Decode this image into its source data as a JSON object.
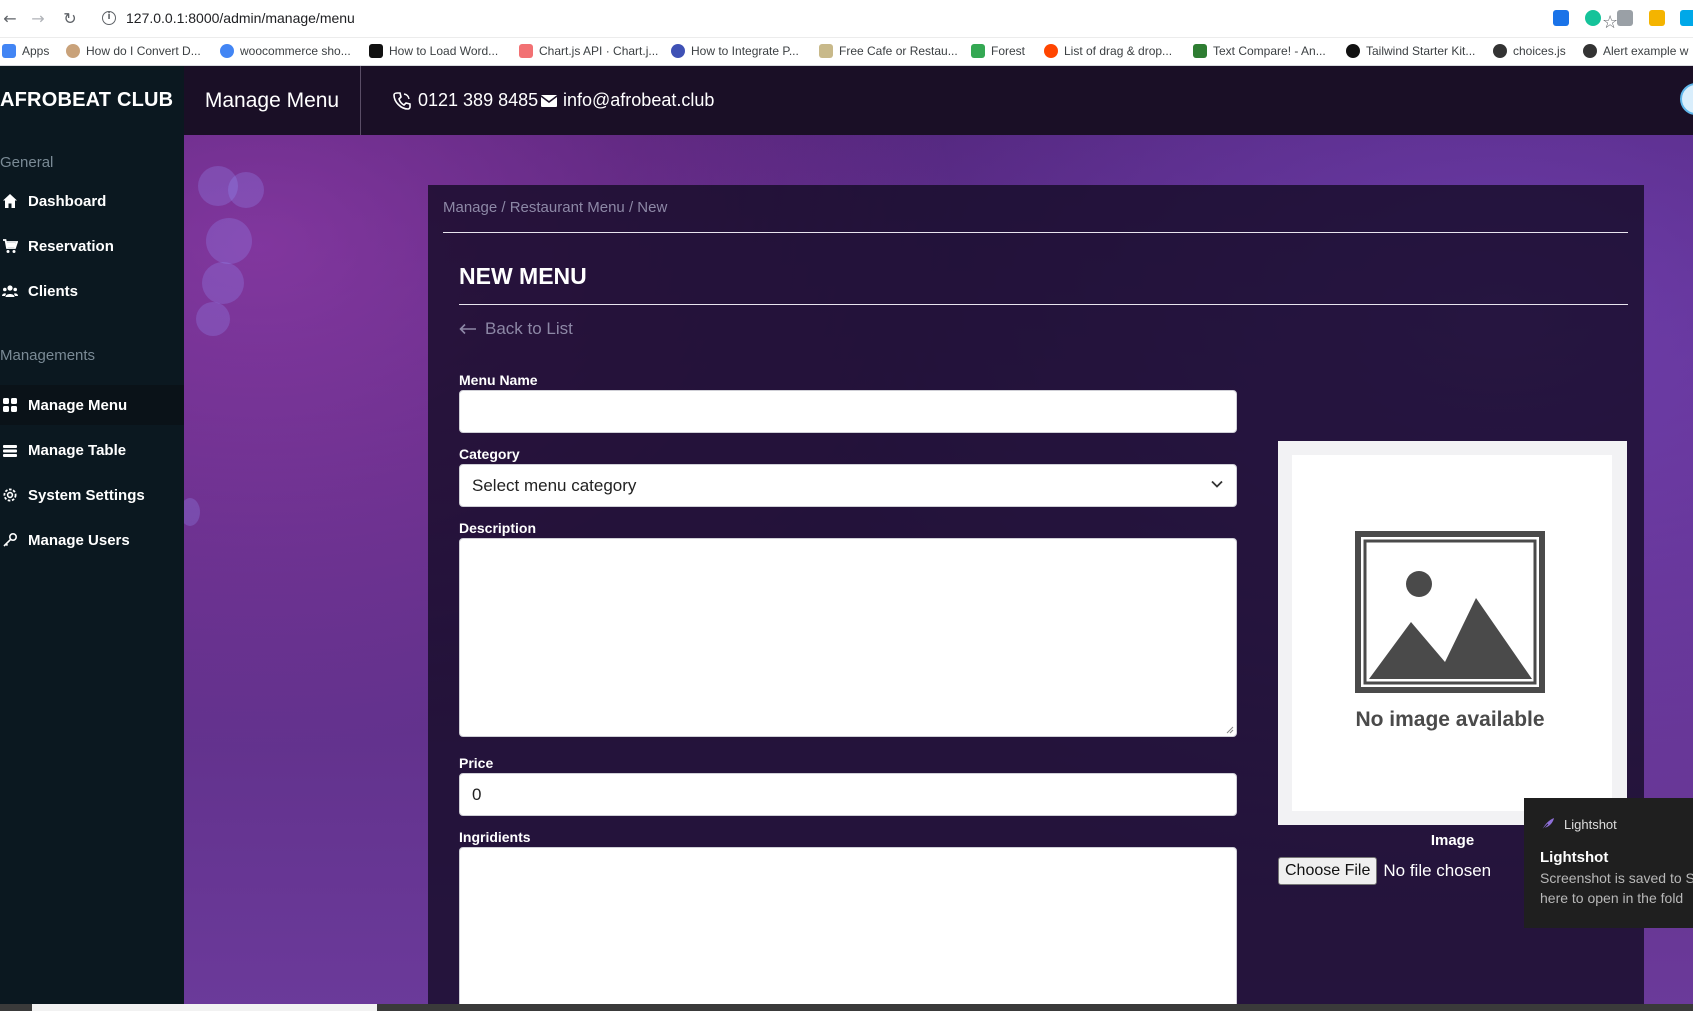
{
  "browser": {
    "url": "127.0.0.1:8000/admin/manage/menu",
    "bookmarks": [
      {
        "label": "Apps",
        "color": "#4285f4"
      },
      {
        "label": "How do I Convert D...",
        "color": "#c9a27a"
      },
      {
        "label": "woocommerce sho...",
        "color": "#4285f4"
      },
      {
        "label": "How to Load Word...",
        "color": "#111111"
      },
      {
        "label": "Chart.js API · Chart.j...",
        "color": "#f27173"
      },
      {
        "label": "How to Integrate P...",
        "color": "#3f51b5"
      },
      {
        "label": "Free Cafe or Restau...",
        "color": "#c8b98a"
      },
      {
        "label": "Forest",
        "color": "#34a853"
      },
      {
        "label": "List of drag & drop...",
        "color": "#ff4500"
      },
      {
        "label": "Text Compare! - An...",
        "color": "#2e7d32"
      },
      {
        "label": "Tailwind Starter Kit...",
        "color": "#111111"
      },
      {
        "label": "choices.js",
        "color": "#333333"
      },
      {
        "label": "Alert example w",
        "color": "#333333"
      }
    ]
  },
  "app": {
    "brand": "AFROBEAT CLUB",
    "page_heading": "Manage Menu",
    "phone": "0121 389 8485",
    "email": "info@afrobeat.club"
  },
  "sidebar": {
    "group_general": "General",
    "group_managements": "Managements",
    "items": [
      {
        "label": "Dashboard",
        "icon": "home-icon"
      },
      {
        "label": "Reservation",
        "icon": "cart-icon"
      },
      {
        "label": "Clients",
        "icon": "users-icon"
      },
      {
        "label": "Manage Menu",
        "icon": "grid-icon",
        "active": true
      },
      {
        "label": "Manage Table",
        "icon": "table-icon"
      },
      {
        "label": "System Settings",
        "icon": "gear-icon"
      },
      {
        "label": "Manage Users",
        "icon": "key-icon"
      }
    ]
  },
  "form": {
    "breadcrumb": "Manage / Restaurant Menu / New",
    "title": "NEW MENU",
    "back_link": "Back to List",
    "menu_name_label": "Menu Name",
    "menu_name_value": "",
    "category_label": "Category",
    "category_value": "Select menu category",
    "description_label": "Description",
    "price_label": "Price",
    "price_value": "0",
    "ingredients_label": "Ingridients"
  },
  "image_panel": {
    "placeholder_text": "No image available",
    "caption": "Image",
    "choose_file": "Choose File",
    "file_status": "No file chosen"
  },
  "toast": {
    "app_name": "Lightshot",
    "title": "Lightshot",
    "message": "Screenshot is saved to S\nhere to open in the fold"
  },
  "colors": {
    "sidebar_bg": "#0b1820",
    "topbar_bg": "#1a0f26",
    "panel_bg": "#160c28"
  }
}
